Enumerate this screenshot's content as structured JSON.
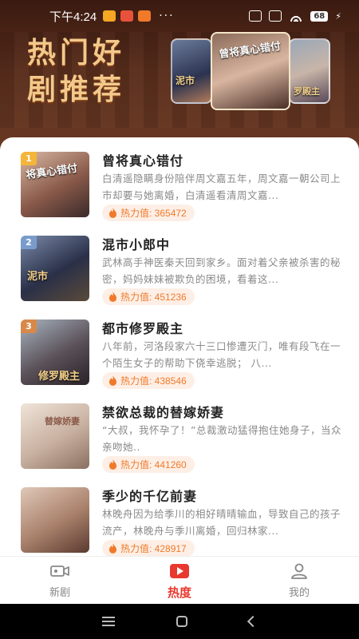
{
  "status_bar": {
    "time": "下午4:24",
    "dots": "···",
    "battery": "68",
    "app_colors": [
      "#f5a623",
      "#e8523a",
      "#f07a2a"
    ]
  },
  "banner": {
    "title_line1": "热门好",
    "title_line2": "剧推荐",
    "posters": [
      {
        "text": "泥市"
      },
      {
        "text": "曾将真心错付"
      },
      {
        "text": "罗殿主"
      }
    ]
  },
  "heat_label": "热力值:",
  "items": [
    {
      "rank": "1",
      "rank_color": "#f3b53a",
      "title": "曾将真心错付",
      "desc": "白清遥隐瞒身份陪伴周文嘉五年，周文嘉一朝公司上市却要与她离婚，白清遥看清周文嘉...",
      "heat": "热力值: 365472",
      "thumb_text": "将真心错付",
      "thumb_colors": [
        "#c9a48c",
        "#6b4a3e"
      ]
    },
    {
      "rank": "2",
      "rank_color": "#7a9ccc",
      "title": "混市小郎中",
      "desc": "武林高手神医秦天回到家乡。面对着父亲被杀害的秘密，妈妈妹妹被欺负的困境，看着这...",
      "heat": "热力值: 451236",
      "thumb_text": "泥市",
      "thumb_colors": [
        "#5c6a8a",
        "#2a2f45"
      ]
    },
    {
      "rank": "3",
      "rank_color": "#d8894a",
      "title": "都市修罗殿主",
      "desc": "八年前，河洛段家六十三口惨遭灭门，唯有段飞在一个陌生女子的帮助下侥幸逃脱； 八...",
      "heat": "热力值: 438546",
      "thumb_text": "修罗殿主",
      "thumb_colors": [
        "#8a98a8",
        "#3a3038"
      ]
    },
    {
      "rank": "",
      "rank_color": "",
      "title": "禁欲总裁的替嫁娇妻",
      "desc": "“大叔，我怀孕了！”总裁激动猛得抱住她身子，当众亲吻她..",
      "heat": "热力值: 441260",
      "thumb_text": "替嫁娇妻",
      "thumb_colors": [
        "#e8d8c8",
        "#b8a090"
      ]
    },
    {
      "rank": "",
      "rank_color": "",
      "title": "季少的千亿前妻",
      "desc": "林晚舟因为给季川的相好晴晴输血，导致自己的孩子流产，林晚舟与季川离婚，回归林家...",
      "heat": "热力值: 428917",
      "thumb_text": "",
      "thumb_colors": [
        "#c8a898",
        "#8a6a5a"
      ]
    }
  ],
  "bottom_nav": [
    {
      "label": "新剧",
      "icon": "video-camera-icon"
    },
    {
      "label": "热度",
      "icon": "play-icon",
      "active": true
    },
    {
      "label": "我的",
      "icon": "user-icon"
    }
  ],
  "colors": {
    "accent": "#e8382f",
    "heat": "#f07a2a",
    "banner_title": "#f3c98a"
  }
}
